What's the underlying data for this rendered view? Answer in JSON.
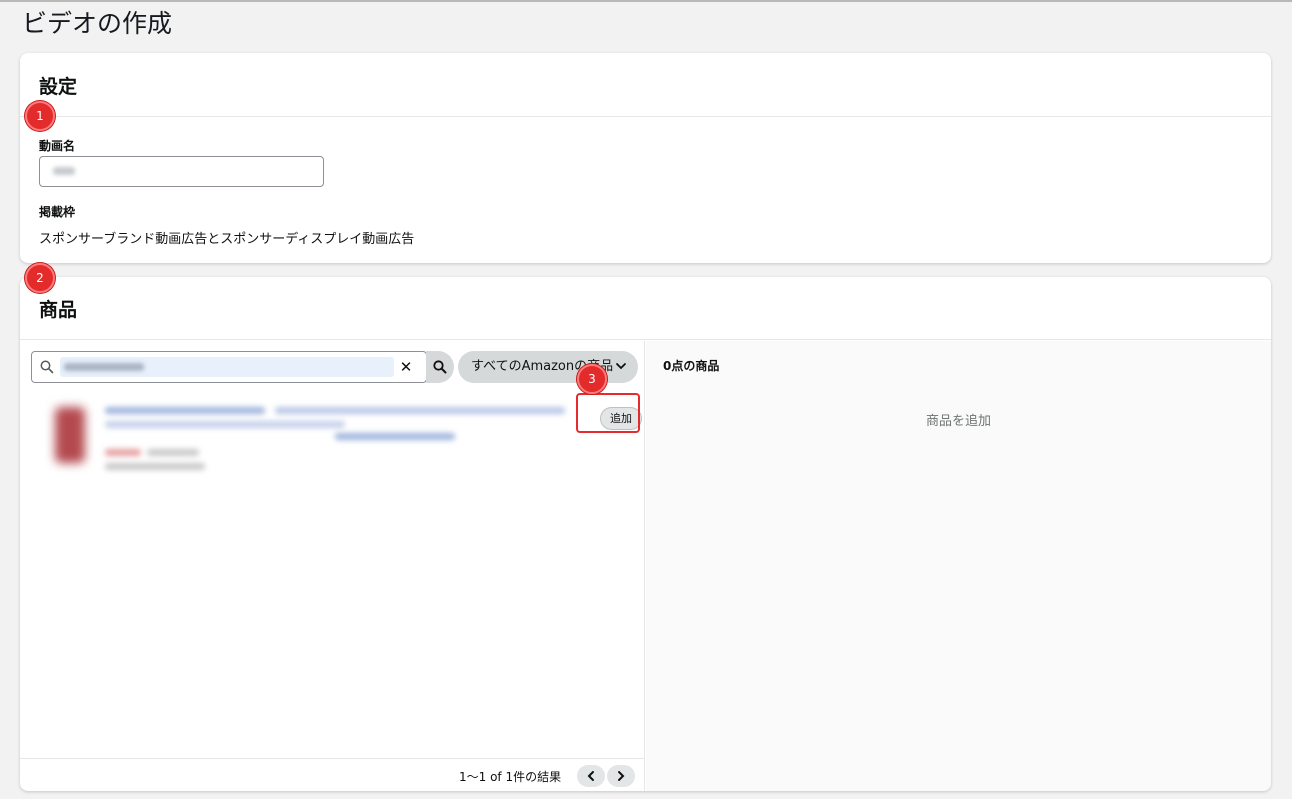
{
  "page": {
    "title": "ビデオの作成"
  },
  "settings": {
    "title": "設定",
    "video_name_label": "動画名",
    "placement_label": "掲載枠",
    "placement_value": "スポンサーブランド動画広告とスポンサーディスプレイ動画広告"
  },
  "products": {
    "title": "商品",
    "scope_label": "すべてのAmazonの商品",
    "add_label": "追加",
    "pagination": "1～1 of 1件の結果",
    "selected_count_title": "0点の商品",
    "empty_message": "商品を追加"
  },
  "markers": [
    "1",
    "2",
    "3"
  ],
  "colors": {
    "marker": "#e32b2b",
    "highlight": "#e52b2b",
    "background": "#f2f2f2"
  },
  "icons": [
    "search-icon",
    "clear-icon",
    "chevron-down-icon",
    "chevron-left-icon",
    "chevron-right-icon"
  ]
}
